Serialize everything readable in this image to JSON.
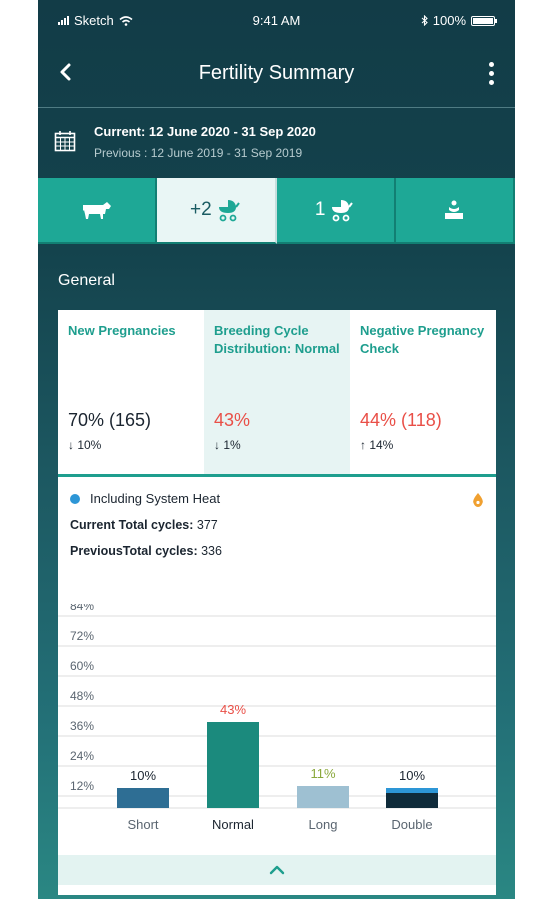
{
  "status": {
    "carrier": "Sketch",
    "time": "9:41 AM",
    "battery": "100%",
    "battery_fraction": 1.0
  },
  "nav": {
    "title": "Fertility Summary",
    "back_icon": "chevron-left-icon",
    "more_icon": "more-vertical-icon"
  },
  "dates": {
    "current": "Current: 12 June 2020 - 31 Sep 2020",
    "previous": "Previous : 12 June 2019 - 31 Sep 2019"
  },
  "tabs": [
    {
      "icon": "cow-icon",
      "label": ""
    },
    {
      "icon": "stroller-icon",
      "label": "+2"
    },
    {
      "icon": "stroller-icon",
      "label": "1"
    },
    {
      "icon": "calf-icon",
      "label": ""
    }
  ],
  "section": {
    "title": "General"
  },
  "stats": [
    {
      "label": "New Pregnancies",
      "value": "70% (165)",
      "delta": "↓ 10%"
    },
    {
      "label": "Breeding Cycle Distribution: Normal",
      "value": "43%",
      "delta": "↓ 1%"
    },
    {
      "label": "Negative Pregnancy Check",
      "value": "44% (118)",
      "delta": "↑ 14%"
    }
  ],
  "info": {
    "legend": "Including System Heat",
    "current_label": "Current Total cycles:",
    "current_value": "377",
    "previous_label": "PreviousTotal cycles:",
    "previous_value": "336"
  },
  "colors": {
    "teal": "#1ea896",
    "red": "#e94f47",
    "blue": "#2d96d6",
    "orange": "#f0a030",
    "olive": "#8aa83c"
  },
  "chart_data": {
    "type": "bar",
    "categories": [
      "Short",
      "Normal",
      "Long",
      "Double"
    ],
    "values": [
      10,
      43,
      11,
      10
    ],
    "labels": [
      "10%",
      "43%",
      "11%",
      "10%"
    ],
    "bar_colors": [
      "#2e6e94",
      "#1b8a7d",
      "#9ec0d2",
      "#0f2b3a"
    ],
    "label_colors": [
      "#1b2530",
      "#e94f47",
      "#8aa83c",
      "#1b2530"
    ],
    "yticks": [
      "84%",
      "72%",
      "60%",
      "48%",
      "36%",
      "24%",
      "12%"
    ],
    "ylim": [
      0,
      96
    ],
    "double_top_accent": "#2d96d6"
  }
}
